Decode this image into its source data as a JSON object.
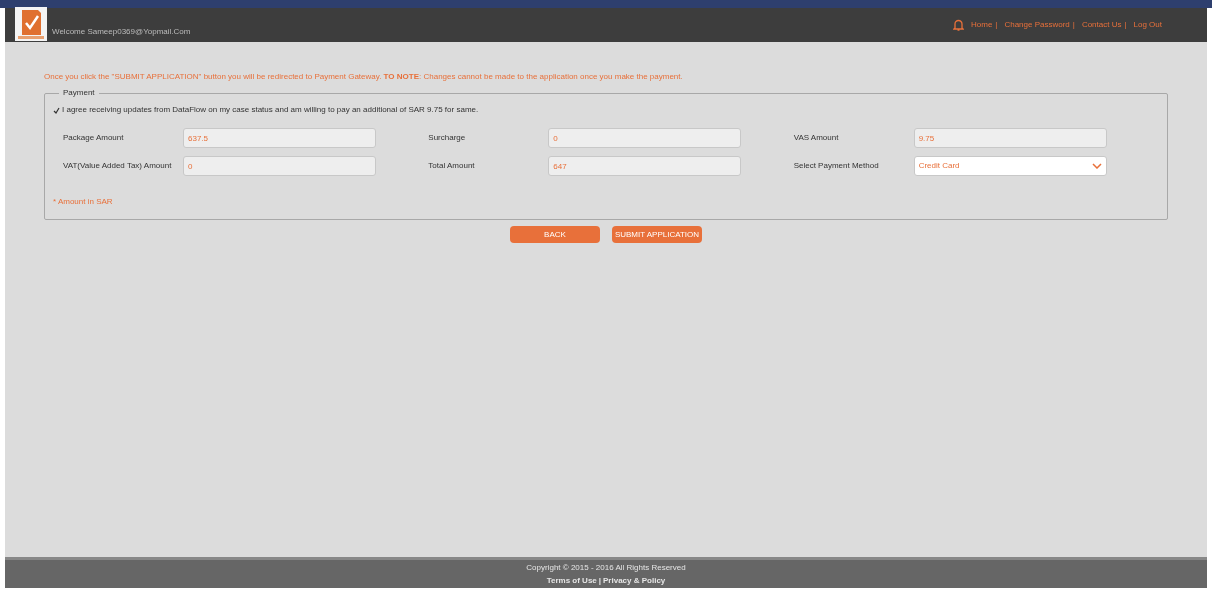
{
  "header": {
    "welcome": "Welcome Sameep0369@Yopmail.Com",
    "links": [
      "Home",
      "Change Password",
      "Contact Us",
      "Log Out"
    ],
    "separator": "|"
  },
  "notice": "Once you click the \"SUBMIT APPLICATION\" button you will be redirected to Payment Gateway. **TO NOTE**: Changes cannot be made to the application once you make the payment.",
  "payment": {
    "legend": "Payment",
    "consent": {
      "checked": true,
      "text": "I agree receiving updates from DataFlow on my case status and am willing to pay an additional of SAR 9.75 for same."
    },
    "fields": [
      {
        "label": "Package Amount",
        "value": "637.5",
        "kind": "readonly"
      },
      {
        "label": "Surcharge",
        "value": "0",
        "kind": "readonly"
      },
      {
        "label": "VAS Amount",
        "value": "9.75",
        "kind": "readonly"
      },
      {
        "label": "VAT(Value Added Tax) Amount",
        "value": "0",
        "kind": "readonly"
      },
      {
        "label": "Total Amount",
        "value": "647",
        "kind": "readonly"
      },
      {
        "label": "Select Payment Method",
        "value": "Credit Card",
        "kind": "select"
      }
    ],
    "note": "* Amount in SAR"
  },
  "buttons": [
    "BACK",
    "SUBMIT APPLICATION"
  ],
  "footer": {
    "copyright": "Copyright © 2015 - 2016 All Rights Reserved",
    "links": [
      "Terms of Use",
      "Privacy & Policy"
    ],
    "separator": "|"
  }
}
